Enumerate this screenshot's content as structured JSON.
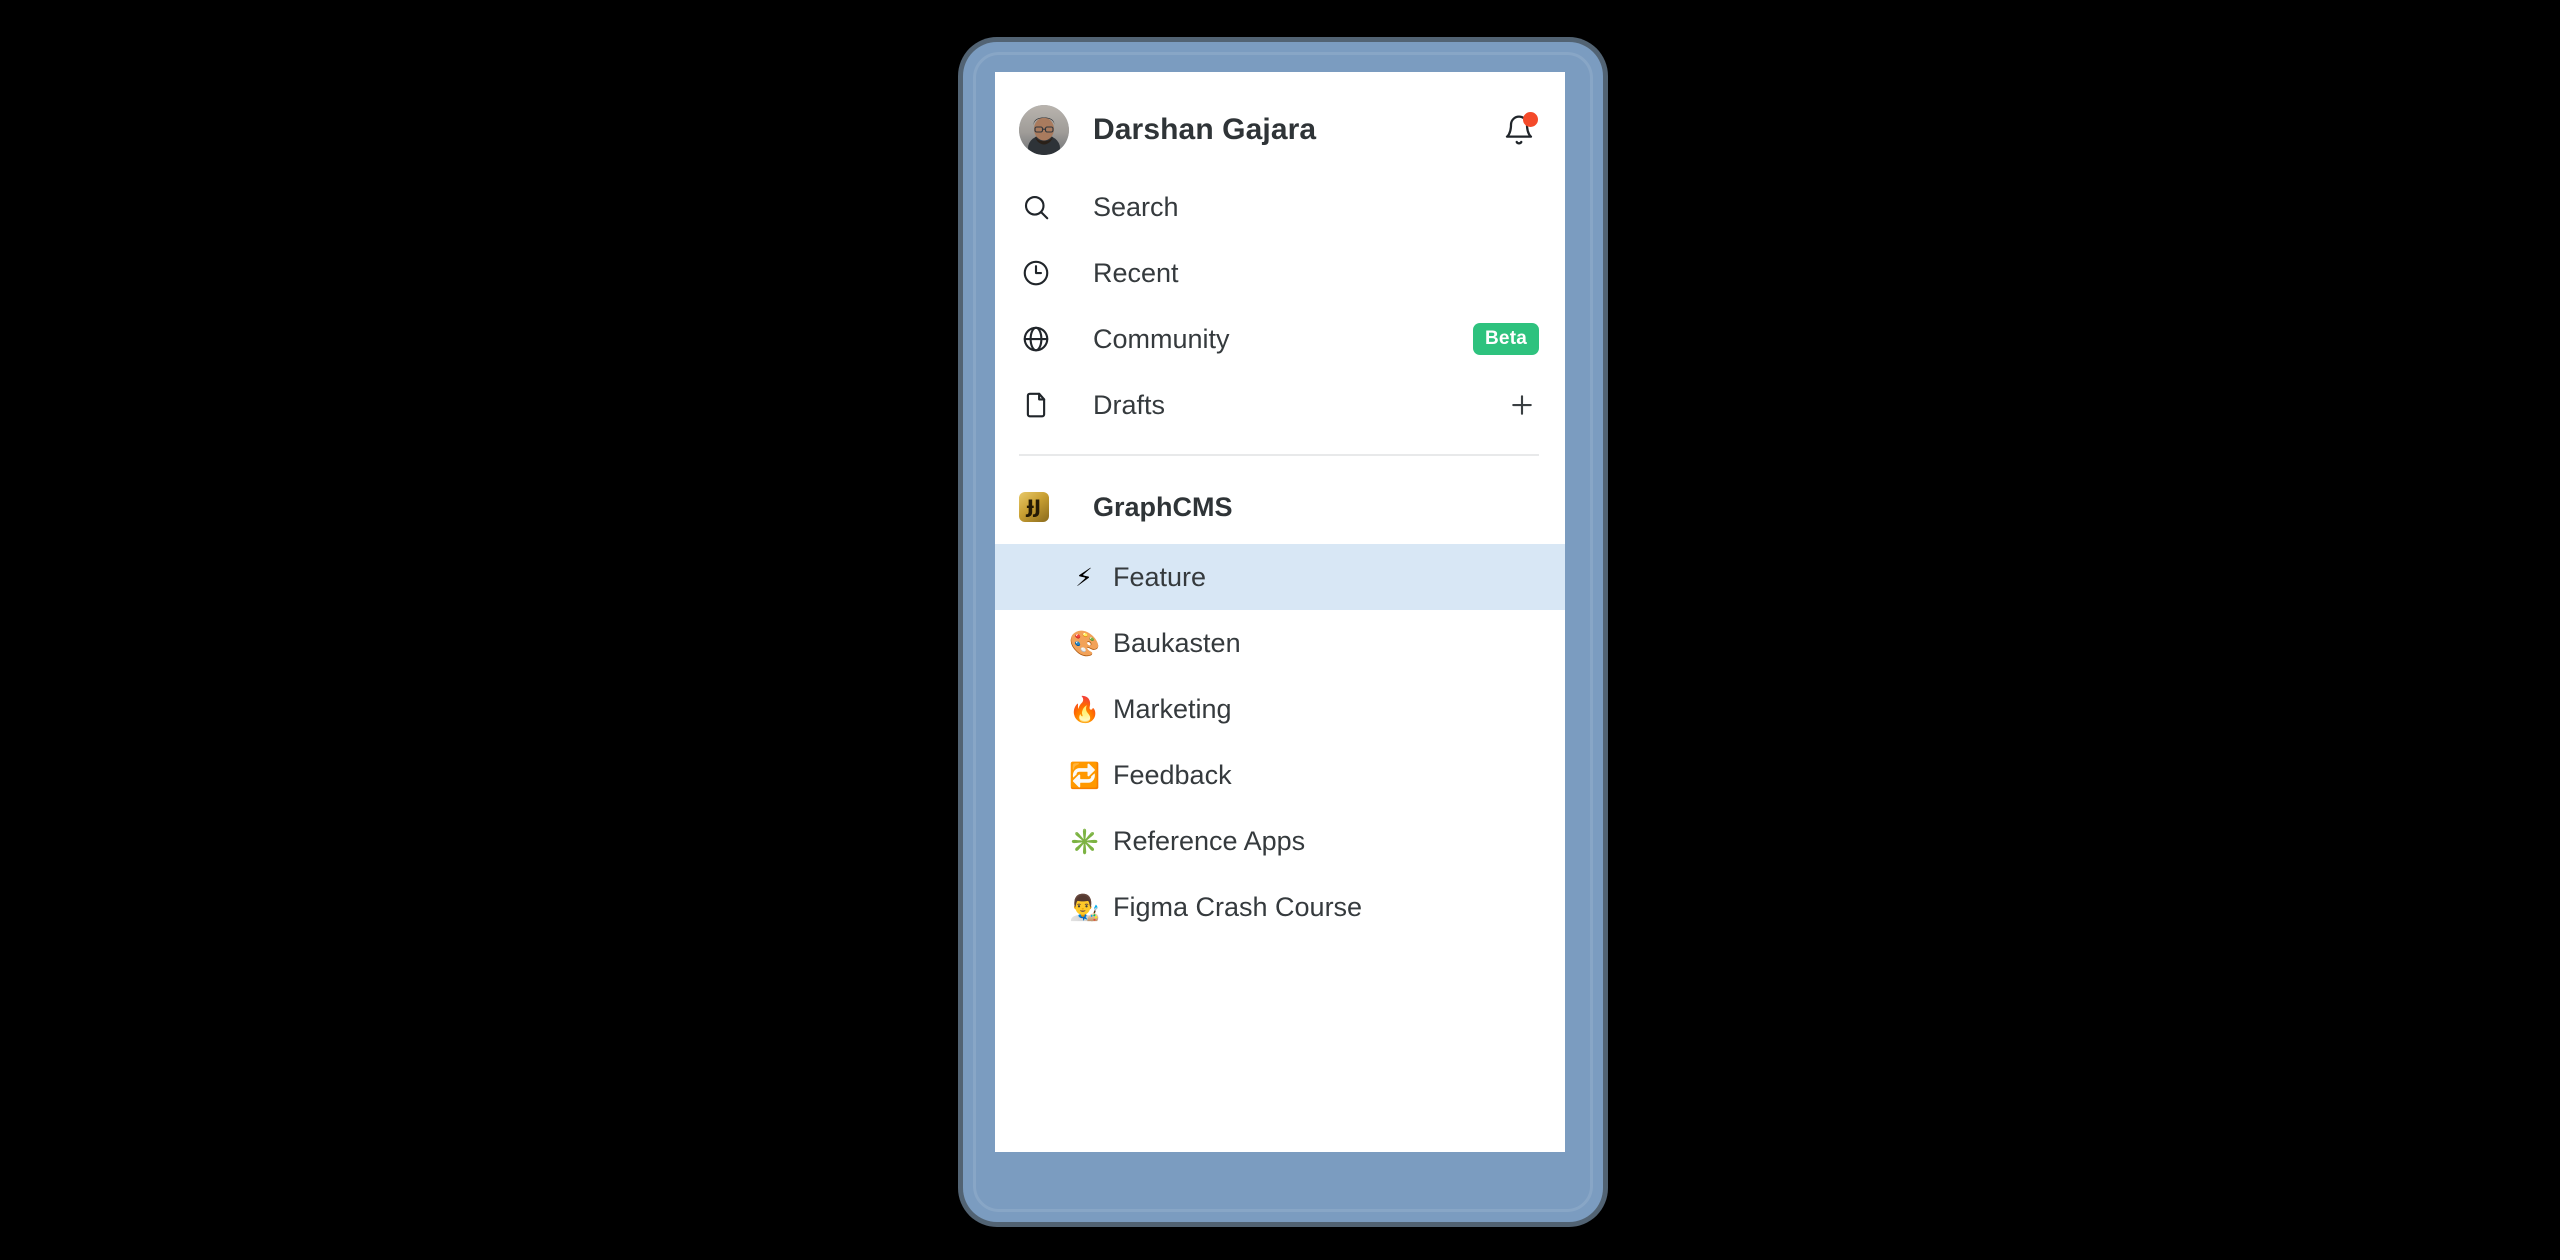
{
  "theme": {
    "background": "#000000",
    "frame_color": "#7b9cc0",
    "panel_background": "#ffffff",
    "selected_row_background": "#d8e7f5",
    "text_color": "#353a3d",
    "badge_green": "#2ec27e",
    "notification_dot": "#f44a2a",
    "divider": "#e8e9ea"
  },
  "header": {
    "user_name": "Darshan Gajara",
    "avatar_name": "user-avatar",
    "notification_icon": "bell-icon",
    "has_unread": true
  },
  "nav": {
    "items": [
      {
        "label": "Search",
        "icon": "search-icon",
        "badge": null,
        "action": null
      },
      {
        "label": "Recent",
        "icon": "clock-icon",
        "badge": null,
        "action": null
      },
      {
        "label": "Community",
        "icon": "globe-icon",
        "badge": "Beta",
        "action": null
      },
      {
        "label": "Drafts",
        "icon": "document-icon",
        "badge": null,
        "action": "plus-icon"
      }
    ]
  },
  "team": {
    "name": "GraphCMS",
    "icon": "graphcms-logo-icon",
    "icon_glyph": "ɈJ"
  },
  "projects": {
    "items": [
      {
        "label": "Feature",
        "emoji": "⚡",
        "emoji_name": "lightning-emoji",
        "selected": true
      },
      {
        "label": "Baukasten",
        "emoji": "🎨",
        "emoji_name": "palette-emoji",
        "selected": false
      },
      {
        "label": "Marketing",
        "emoji": "🔥",
        "emoji_name": "fire-emoji",
        "selected": false
      },
      {
        "label": "Feedback",
        "emoji": "🔁",
        "emoji_name": "repeat-emoji",
        "selected": false
      },
      {
        "label": "Reference Apps",
        "emoji": "✳️",
        "emoji_name": "green-sparkle-emoji",
        "selected": false
      },
      {
        "label": "Figma Crash Course",
        "emoji": "👨‍🎨",
        "emoji_name": "artist-emoji",
        "selected": false
      }
    ]
  }
}
